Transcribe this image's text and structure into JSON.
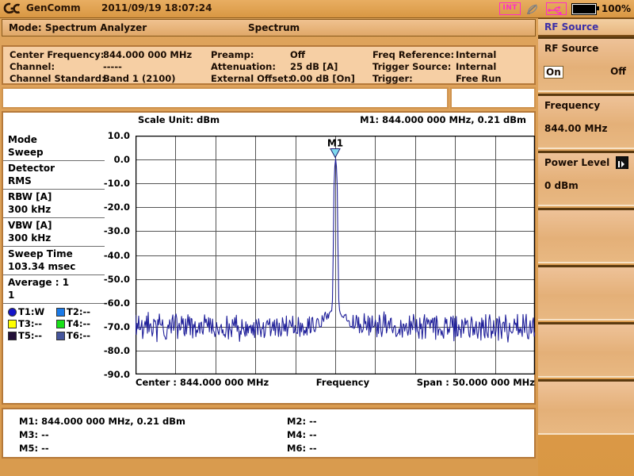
{
  "statusbar": {
    "brand": "GenComm",
    "datetime": "2011/09/19 18:07:24",
    "int_badge": "INT",
    "battery_percent": "100%",
    "icons": [
      "gc-logo-icon",
      "int-icon",
      "satellite-dish-icon",
      "usb-icon",
      "battery-icon"
    ]
  },
  "modebar": {
    "mode": "Mode: Spectrum Analyzer",
    "sub": "Spectrum"
  },
  "param_header": {
    "col1": [
      {
        "label": "Center Frequency:",
        "value": "844.000 000 MHz"
      },
      {
        "label": "Channel:",
        "value": "-----"
      },
      {
        "label": "Channel Standard:",
        "value": "Band 1 (2100)"
      }
    ],
    "col2": [
      {
        "label": "Preamp:",
        "value": "Off"
      },
      {
        "label": "Attenuation:",
        "value": "25 dB  [A]"
      },
      {
        "label": "External Offset:",
        "value": "0.00 dB  [On]"
      }
    ],
    "col3": [
      {
        "label": "Freq Reference:",
        "value": "Internal"
      },
      {
        "label": "Trigger Source:",
        "value": "Internal"
      },
      {
        "label": "Trigger:",
        "value": "Free Run"
      }
    ]
  },
  "settings": [
    {
      "name": "Mode",
      "value": "Sweep"
    },
    {
      "name": "Detector",
      "value": "RMS"
    },
    {
      "name": "RBW [A]",
      "value": "300 kHz"
    },
    {
      "name": "VBW [A]",
      "value": "300 kHz"
    },
    {
      "name": "Sweep Time",
      "value": "103.34 msec"
    },
    {
      "name": "Average : 1",
      "value": "1"
    }
  ],
  "traces": [
    {
      "label": "T1:W",
      "color": "#1414c8",
      "shape": "circle"
    },
    {
      "label": "T2:--",
      "color": "#1a7ae8",
      "shape": "square"
    },
    {
      "label": "T3:--",
      "color": "#ffff00",
      "shape": "square"
    },
    {
      "label": "T4:--",
      "color": "#18e018",
      "shape": "square"
    },
    {
      "label": "T5:--",
      "color": "#231038",
      "shape": "square"
    },
    {
      "label": "T6:--",
      "color": "#45559c",
      "shape": "square"
    }
  ],
  "plot": {
    "scale_unit": "Scale Unit: dBm",
    "marker_readout": "M1: 844.000 000 MHz, 0.21 dBm",
    "marker_label": "M1",
    "center_label": "Center : 844.000 000 MHz",
    "x_axis_label": "Frequency",
    "span_label": "Span : 50.000 000 MHz",
    "trace_color": "#20209a",
    "marker_color": "#7fd9ee"
  },
  "chart_data": {
    "type": "line",
    "title": "Spectrum Analyzer Trace",
    "xlabel": "Frequency",
    "ylabel": "dBm",
    "scale_unit": "dBm",
    "center_frequency_mhz": 844.0,
    "span_mhz": 50.0,
    "xlim_mhz": [
      819.0,
      869.0
    ],
    "ylim": [
      -90.0,
      10.0
    ],
    "y_ticks": [
      10.0,
      0.0,
      -10.0,
      -20.0,
      -30.0,
      -40.0,
      -50.0,
      -60.0,
      -70.0,
      -80.0,
      -90.0
    ],
    "y_tick_labels": [
      "10.0",
      "0.0",
      "-10.0",
      "-20.0",
      "-30.0",
      "-40.0",
      "-50.0",
      "-60.0",
      "-70.0",
      "-80.0",
      "-90.0"
    ],
    "grid": true,
    "grid_divisions_x": 10,
    "grid_divisions_y": 10,
    "legend": false,
    "noise_floor_dbm": -70.0,
    "noise_ripple_db": 5.0,
    "peak": {
      "frequency_mhz": 844.0,
      "amplitude_dbm": 0.21,
      "marker": "M1"
    },
    "series": [
      {
        "name": "T1",
        "color": "#20209a",
        "description": "CW carrier at 844 MHz, peak 0.21 dBm, skirt shoulder around -58 dBm, noise floor about -70 dBm"
      }
    ],
    "annotations": [
      {
        "text": "M1",
        "frequency_mhz": 844.0,
        "amplitude_dbm": 0.21
      },
      {
        "text": "M1: 844.000 000 MHz, 0.21 dBm",
        "position": "top-right"
      },
      {
        "text": "Scale Unit: dBm",
        "position": "top-left"
      },
      {
        "text": "Center : 844.000 000 MHz",
        "position": "bottom-left"
      },
      {
        "text": "Span : 50.000 000 MHz",
        "position": "bottom-right"
      }
    ]
  },
  "marker_table": [
    {
      "label": "M1:",
      "value": "844.000 000 MHz, 0.21 dBm"
    },
    {
      "label": "M2:",
      "value": "--"
    },
    {
      "label": "M3:",
      "value": "--"
    },
    {
      "label": "M4:",
      "value": "--"
    },
    {
      "label": "M5:",
      "value": "--"
    },
    {
      "label": "M6:",
      "value": "--"
    }
  ],
  "right_menu": {
    "title": "RF Source",
    "slots": [
      {
        "label": "RF Source",
        "option_on": "On",
        "option_off": "Off",
        "selected": "On"
      },
      {
        "label": "Frequency",
        "value": "844.00 MHz"
      },
      {
        "label": "Power Level",
        "value": "0 dBm",
        "icon": "step-icon"
      },
      {
        "label": "",
        "value": ""
      },
      {
        "label": "",
        "value": ""
      },
      {
        "label": "",
        "value": ""
      },
      {
        "label": "",
        "value": ""
      }
    ]
  }
}
